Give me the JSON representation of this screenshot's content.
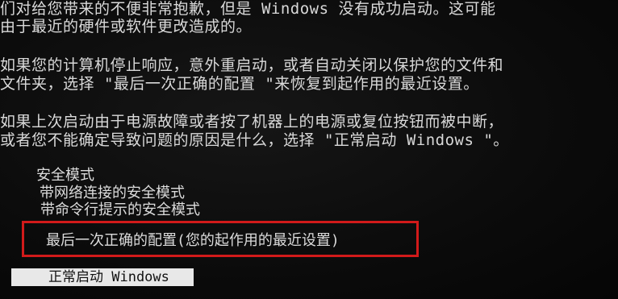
{
  "message": {
    "lines": [
      "们对给您带来的不便非常抱歉，但是 Windows 没有成功启动。这可能",
      "由于最近的硬件或软件更改造成的。",
      "如果您的计算机停止响应，意外重启动，或者自动关闭以保护您的文件和",
      "文件夹，选择 \"最后一次正确的配置 \"来恢复到起作用的最近设置。",
      "如果上次启动由于电源故障或者按了机器上的电源或复位按钮而被中断，",
      "或者您不能确定导致问题的原因是什么，选择 \"正常启动 Windows \"。"
    ]
  },
  "menu": {
    "options": [
      "安全模式",
      "带网络连接的安全模式",
      "带命令行提示的安全模式",
      "最后一次正确的配置(您的起作用的最近设置)",
      "正常启动 Windows"
    ],
    "selected_index": 4,
    "highlight_color": "#d21a1a"
  }
}
